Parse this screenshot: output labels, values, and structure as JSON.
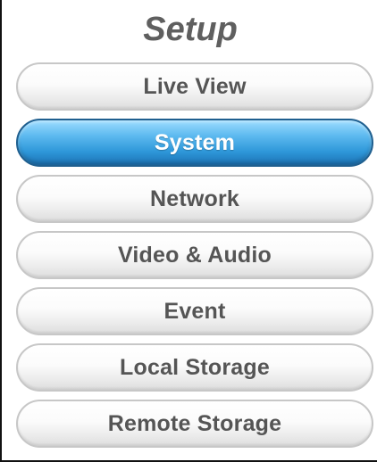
{
  "title": "Setup",
  "menu": {
    "items": [
      {
        "label": "Live View"
      },
      {
        "label": "System"
      },
      {
        "label": "Network"
      },
      {
        "label": "Video & Audio"
      },
      {
        "label": "Event"
      },
      {
        "label": "Local Storage"
      },
      {
        "label": "Remote Storage"
      }
    ],
    "active_index": 1
  },
  "colors": {
    "active_gradient_top": "#9ddcff",
    "active_gradient_bottom": "#1c72b4",
    "inactive_text": "#555555",
    "title_text": "#5f5f5f"
  }
}
